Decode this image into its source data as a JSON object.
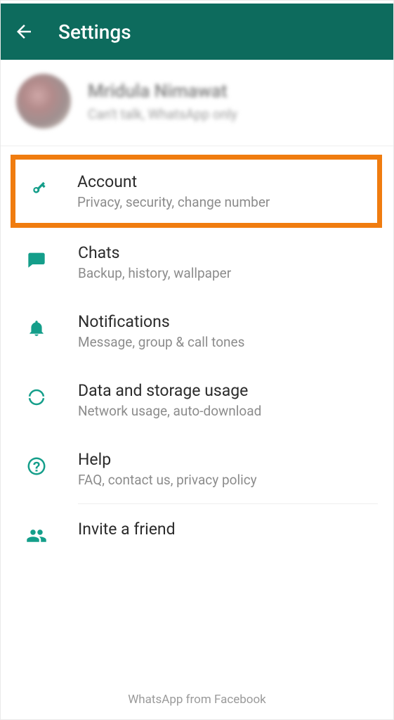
{
  "appbar": {
    "title": "Settings"
  },
  "profile": {
    "name": "Mridula Nimawat",
    "status": "Can't talk, WhatsApp only"
  },
  "items": {
    "account": {
      "title": "Account",
      "sub": "Privacy, security, change number"
    },
    "chats": {
      "title": "Chats",
      "sub": "Backup, history, wallpaper"
    },
    "notif": {
      "title": "Notifications",
      "sub": "Message, group & call tones"
    },
    "data": {
      "title": "Data and storage usage",
      "sub": "Network usage, auto-download"
    },
    "help": {
      "title": "Help",
      "sub": "FAQ, contact us, privacy policy"
    },
    "invite": {
      "title": "Invite a friend"
    }
  },
  "footer": "WhatsApp from Facebook",
  "colors": {
    "appbar": "#0d6b5d",
    "highlight": "#f07c0f",
    "icon": "#1aa28c"
  }
}
